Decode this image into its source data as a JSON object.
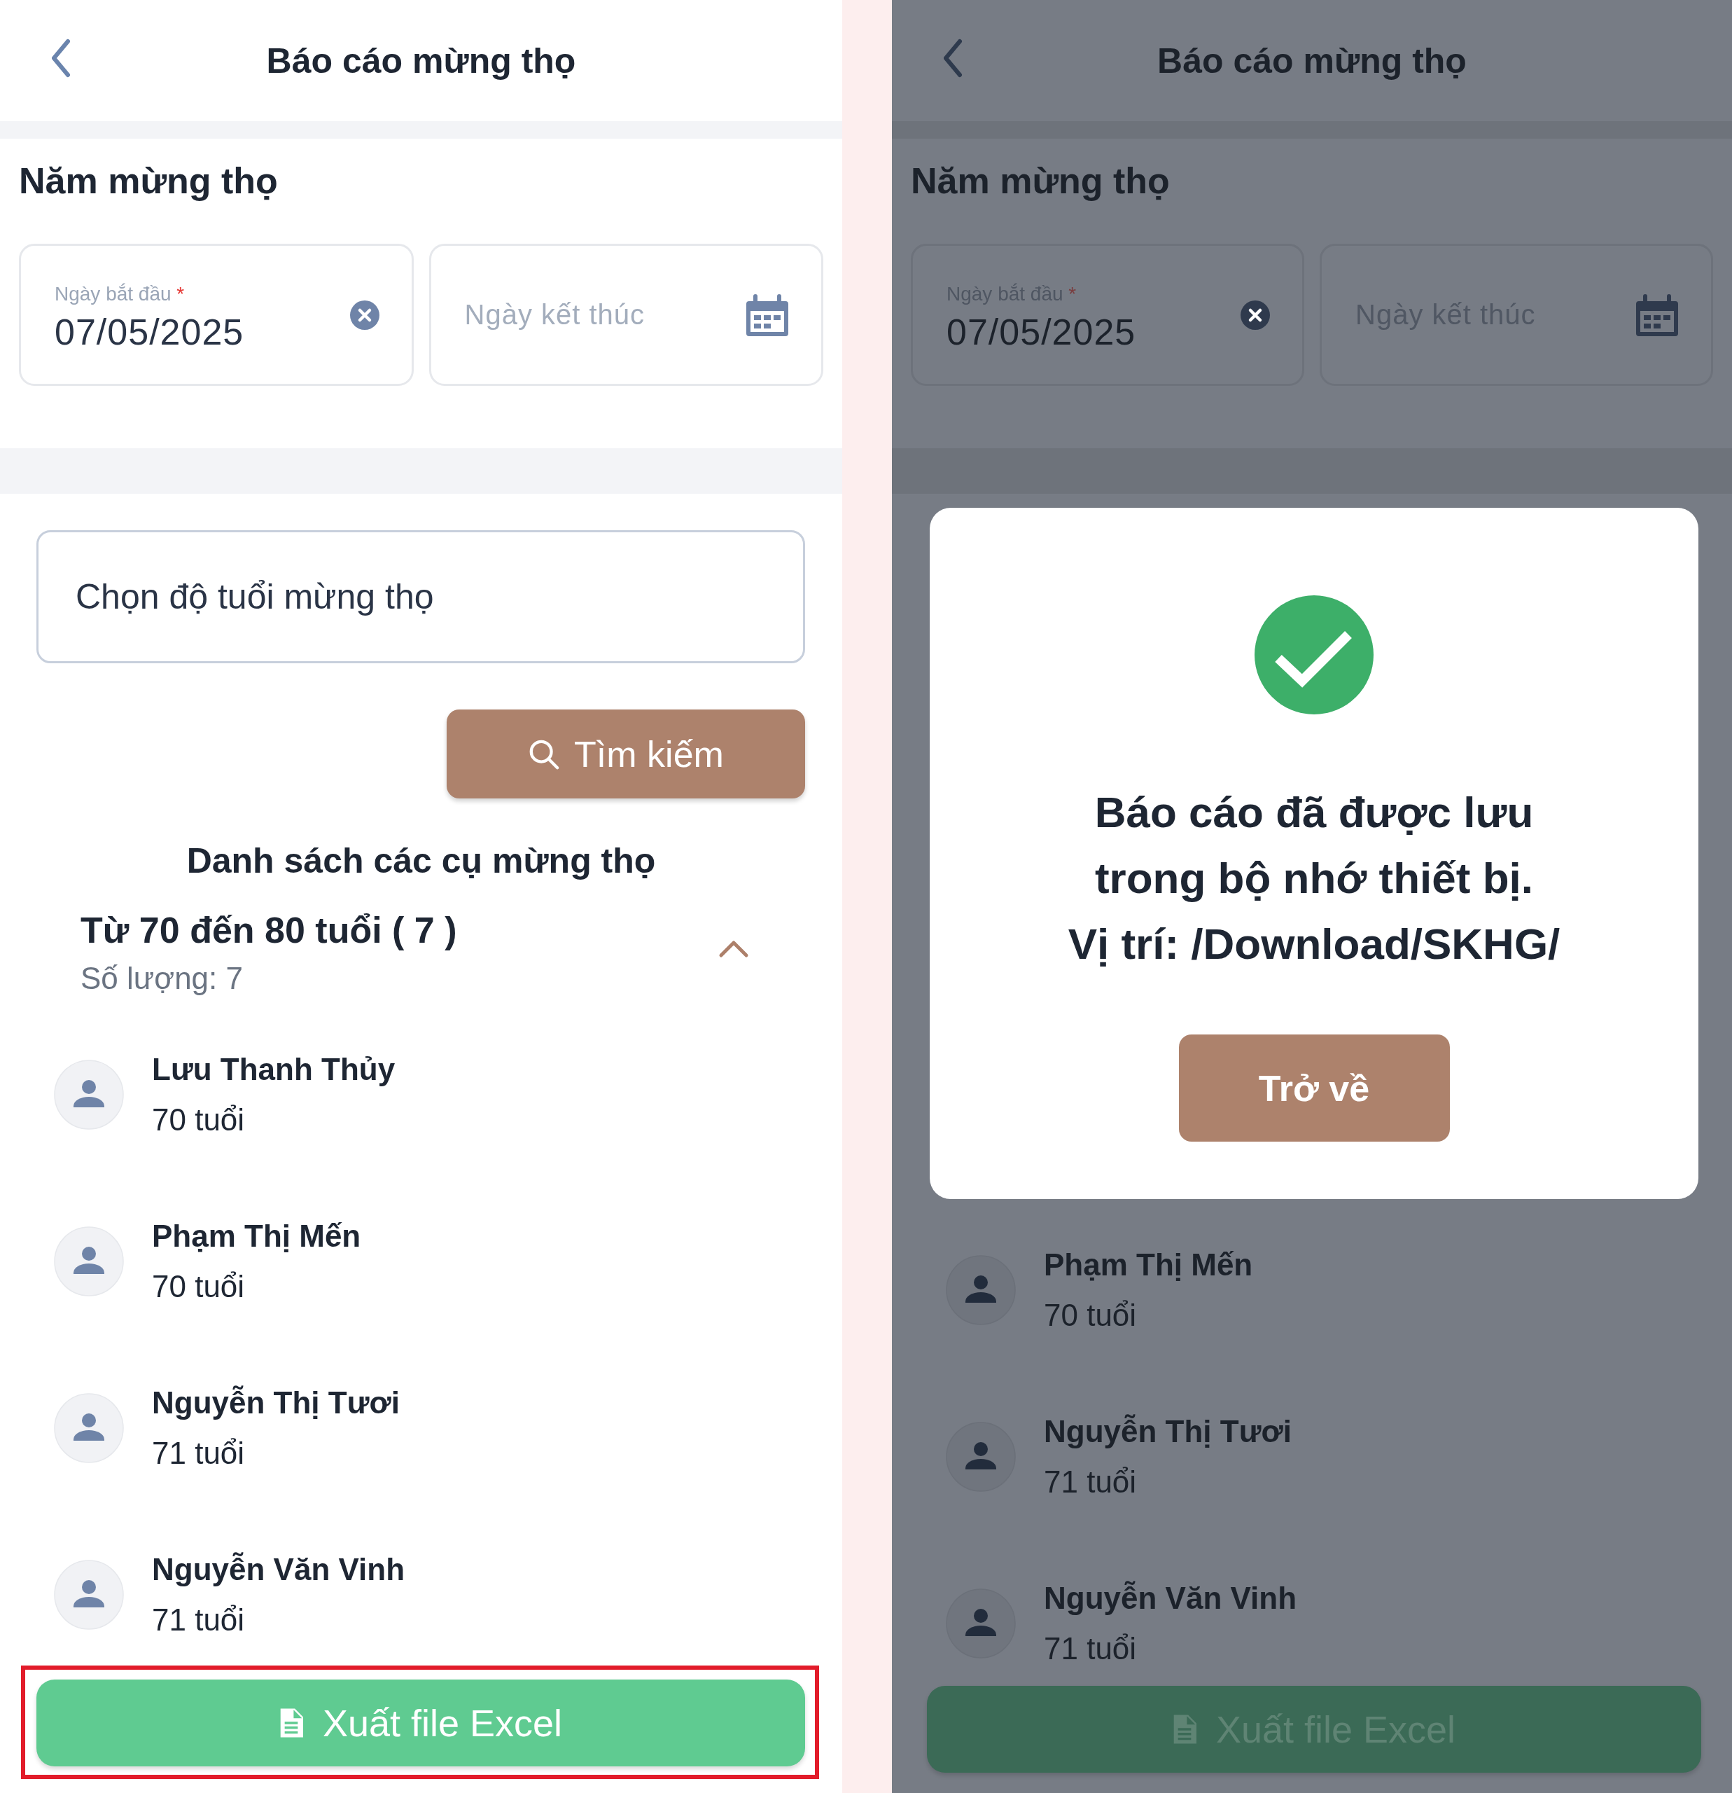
{
  "screens": [
    {
      "dimmed": false,
      "header": {
        "title": "Báo cáo mừng thọ"
      },
      "section_title": "Năm mừng thọ",
      "start_date": {
        "label": "Ngày bắt đầu",
        "required_mark": "*",
        "value": "07/05/2025"
      },
      "end_date": {
        "placeholder": "Ngày kết thúc"
      },
      "age_select": {
        "placeholder": "Chọn độ tuổi mừng thọ"
      },
      "search_button": "Tìm kiếm",
      "list_title": "Danh sách các cụ mừng thọ",
      "group": {
        "title": "Từ 70 đến 80 tuổi ( 7 )",
        "count": "Số lượng: 7",
        "expanded": true
      },
      "people": [
        {
          "name": "Lưu Thanh Thủy",
          "age": "70 tuổi"
        },
        {
          "name": "Phạm Thị Mến",
          "age": "70 tuổi"
        },
        {
          "name": "Nguyễn Thị Tươi",
          "age": "71 tuổi"
        },
        {
          "name": "Nguyễn Văn Vinh",
          "age": "71 tuổi"
        }
      ],
      "export_button": {
        "label": "Xuất file Excel",
        "highlighted": true
      }
    },
    {
      "dimmed": true,
      "header": {
        "title": "Báo cáo mừng thọ"
      },
      "section_title": "Năm mừng thọ",
      "start_date": {
        "label": "Ngày bắt đầu",
        "required_mark": "*",
        "value": "07/05/2025"
      },
      "end_date": {
        "placeholder": "Ngày kết thúc"
      },
      "dialog": {
        "message": "Báo cáo đã được lưu\ntrong bộ nhớ thiết bị.\nVị trí: /Download/SKHG/",
        "button": "Trở về"
      },
      "people": [
        {
          "name": "Phạm Thị Mến",
          "age": "70 tuổi"
        },
        {
          "name": "Nguyễn Thị Tươi",
          "age": "71 tuổi"
        },
        {
          "name": "Nguyễn Văn Vinh",
          "age": "71 tuổi"
        }
      ],
      "export_button": {
        "label": "Xuất file Excel",
        "highlighted": false
      }
    }
  ]
}
